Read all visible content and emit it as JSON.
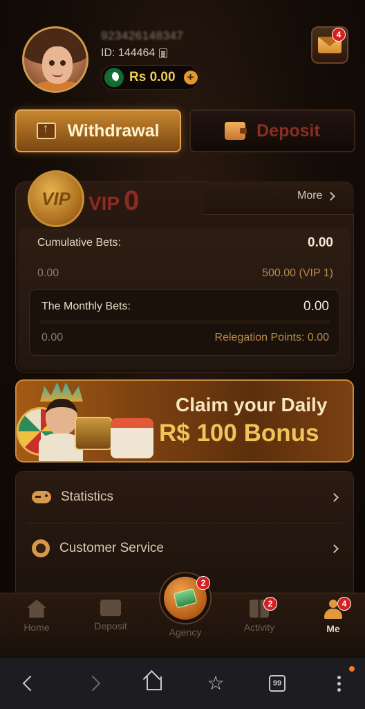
{
  "profile": {
    "phone_masked": "923426148347",
    "id_text": "ID: 144464",
    "balance": "Rs 0.00",
    "mail_badge": "4"
  },
  "actions": {
    "withdrawal": "Withdrawal",
    "deposit": "Deposit"
  },
  "vip": {
    "coin_text": "VIP",
    "label": "VIP",
    "level": "0",
    "more": "More",
    "cumulative_label": "Cumulative Bets:",
    "cumulative_value": "0.00",
    "cumulative_min": "0.00",
    "cumulative_target": "500.00 (VIP 1)",
    "monthly_label": "The Monthly Bets:",
    "monthly_value": "0.00",
    "monthly_min": "0.00",
    "relegation": "Relegation Points: 0.00"
  },
  "banner": {
    "line1": "Claim your Daily",
    "line2": "R$ 100 Bonus"
  },
  "menu": {
    "statistics": "Statistics",
    "customer_service": "Customer Service"
  },
  "nav": {
    "home": "Home",
    "deposit": "Deposit",
    "agency": "Agency",
    "agency_badge": "2",
    "activity": "Activity",
    "activity_badge": "2",
    "me": "Me",
    "me_badge": "4"
  },
  "browser": {
    "tabs_count": "99"
  },
  "colors": {
    "accent_gold": "#f0c45a",
    "vip_red": "#8e2a22",
    "badge_red": "#d81e1e",
    "background": "#140c07"
  }
}
